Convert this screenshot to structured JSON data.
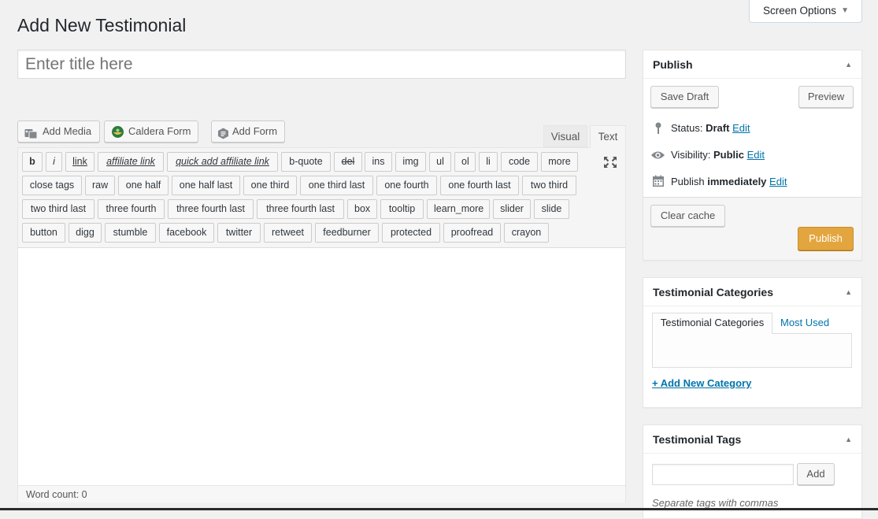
{
  "screen_options": {
    "label": "Screen Options",
    "arrow": "▼"
  },
  "page_title": "Add New Testimonial",
  "title_input": {
    "placeholder": "Enter title here",
    "value": ""
  },
  "media_buttons": [
    {
      "label": "Add Media",
      "icon": "media-icon"
    },
    {
      "label": "Caldera Form",
      "icon": "caldera-icon"
    },
    {
      "label": "Add Form",
      "icon": "form-icon"
    }
  ],
  "editor_tabs": {
    "visual": "Visual",
    "text": "Text"
  },
  "quicktags": [
    "b",
    "i",
    "link",
    "affiliate link",
    "quick add affiliate link",
    "b-quote",
    "del",
    "ins",
    "img",
    "ul",
    "ol",
    "li",
    "code",
    "more",
    "close tags",
    "raw",
    "one half",
    "one half last",
    "one third",
    "one third last",
    "one fourth",
    "one fourth last",
    "two third",
    "two third last",
    "three fourth",
    "three fourth last",
    "three fourth last",
    "box",
    "tooltip",
    "learn_more",
    "slider",
    "slide",
    "button",
    "digg",
    "stumble",
    "facebook",
    "twitter",
    "retweet",
    "feedburner",
    "protected",
    "proofread",
    "crayon"
  ],
  "editor": {
    "content": "",
    "word_count_label": "Word count:",
    "word_count": "0"
  },
  "publish": {
    "title": "Publish",
    "save_draft": "Save Draft",
    "preview": "Preview",
    "status_label": "Status:",
    "status_value": "Draft",
    "visibility_label": "Visibility:",
    "visibility_value": "Public",
    "publish_label": "Publish",
    "publish_value": "immediately",
    "edit": "Edit",
    "clear_cache": "Clear cache",
    "publish_button": "Publish"
  },
  "categories": {
    "title": "Testimonial Categories",
    "tab_all": "Testimonial Categories",
    "tab_most_used": "Most Used",
    "add_new": "+ Add New Category"
  },
  "tags": {
    "title": "Testimonial Tags",
    "input_value": "",
    "add_button": "Add",
    "hint": "Separate tags with commas"
  },
  "colors": {
    "accent": "#0073aa",
    "publish_button": "#e3a63e",
    "background": "#f1f1f1"
  }
}
